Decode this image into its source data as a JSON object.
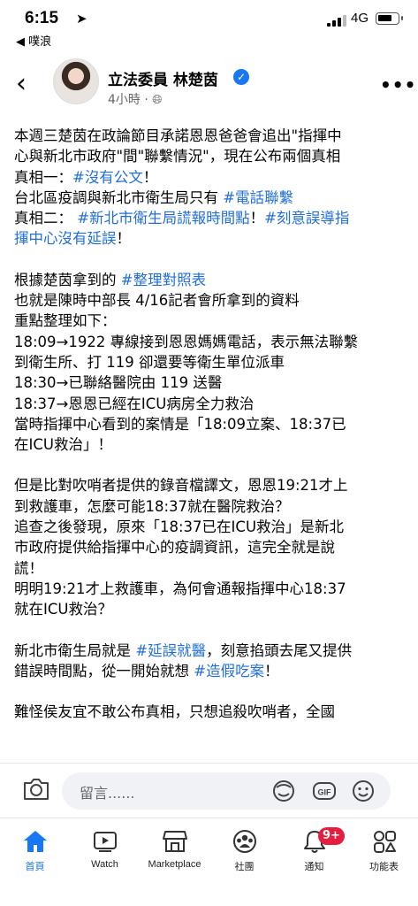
{
  "status_bar": {
    "time": "6:15",
    "back_app": "◀ 噗浪",
    "network": "4G"
  },
  "header": {
    "author": "立法委員 林楚茵",
    "time": "4小時 · ",
    "verified": true
  },
  "post": {
    "lines": [
      [
        {
          "t": "本週三楚茵在政論節目承諾恩恩爸爸會追出\"指揮中"
        }
      ],
      [
        {
          "t": "心與新北市政府\"間\"聯繫情況\"，現在公布兩個真相"
        }
      ],
      [
        {
          "t": "真相一："
        },
        {
          "t": "#沒有公文",
          "tag": true
        },
        {
          "t": "！"
        }
      ],
      [
        {
          "t": "台北區疫調與新北市衛生局只有 "
        },
        {
          "t": "#電話聯繫",
          "tag": true
        }
      ],
      [
        {
          "t": "真相二： "
        },
        {
          "t": "#新北市衛生局謊報時間點",
          "tag": true
        },
        {
          "t": "！"
        },
        {
          "t": "#刻意誤導指",
          "tag": true
        }
      ],
      [
        {
          "t": "揮中心沒有延誤",
          "tag": true
        },
        {
          "t": "！"
        }
      ],
      [],
      [
        {
          "t": "根據楚茵拿到的 "
        },
        {
          "t": "#整理對照表",
          "tag": true
        }
      ],
      [
        {
          "t": "也就是陳時中部長 4/16記者會所拿到的資料"
        }
      ],
      [
        {
          "t": "重點整理如下："
        }
      ],
      [
        {
          "t": "18:09→1922 專線接到恩恩媽媽電話，表示無法聯繫"
        }
      ],
      [
        {
          "t": "到衛生所、打 119 卻還要等衛生單位派車"
        }
      ],
      [
        {
          "t": "18:30→已聯絡醫院由 119 送醫"
        }
      ],
      [
        {
          "t": "18:37→恩恩已經在ICU病房全力救治"
        }
      ],
      [
        {
          "t": "當時指揮中心看到的案情是「18:09立案、18:37已"
        }
      ],
      [
        {
          "t": "在ICU救治」！"
        }
      ],
      [],
      [
        {
          "t": "但是比對吹哨者提供的錄音檔譯文，恩恩19:21才上"
        }
      ],
      [
        {
          "t": "到救護車，怎麼可能18:37就在醫院救治？"
        }
      ],
      [
        {
          "t": "追查之後發現，原來「18:37已在ICU救治」是新北"
        }
      ],
      [
        {
          "t": "市政府提供給指揮中心的疫調資訊，這完全就是說"
        }
      ],
      [
        {
          "t": "謊！"
        }
      ],
      [
        {
          "t": "明明19:21才上救護車，為何會通報指揮中心18:37"
        }
      ],
      [
        {
          "t": "就在ICU救治？"
        }
      ],
      [],
      [
        {
          "t": "新北市衛生局就是 "
        },
        {
          "t": "#延誤就醫",
          "tag": true
        },
        {
          "t": "，刻意掐頭去尾又提供"
        }
      ],
      [
        {
          "t": "錯誤時間點，從一開始就想 "
        },
        {
          "t": "#造假吃案",
          "tag": true
        },
        {
          "t": "！"
        }
      ],
      [],
      [
        {
          "t": "難怪侯友宜不敢公布真相，只想追殺吹哨者，全國"
        }
      ]
    ]
  },
  "comment_bar": {
    "placeholder": "留言......"
  },
  "tabbar": {
    "tabs": [
      {
        "label": "首頁",
        "icon": "home-icon",
        "active": true
      },
      {
        "label": "Watch",
        "icon": "watch-icon"
      },
      {
        "label": "Marketplace",
        "icon": "marketplace-icon"
      },
      {
        "label": "社團",
        "icon": "groups-icon"
      },
      {
        "label": "通知",
        "icon": "bell-icon",
        "badge": "9+"
      },
      {
        "label": "功能表",
        "icon": "menu-icon"
      }
    ]
  },
  "colors": {
    "accent": "#1877f2",
    "hashtag": "#216fdb",
    "badge": "#e41e3f"
  }
}
